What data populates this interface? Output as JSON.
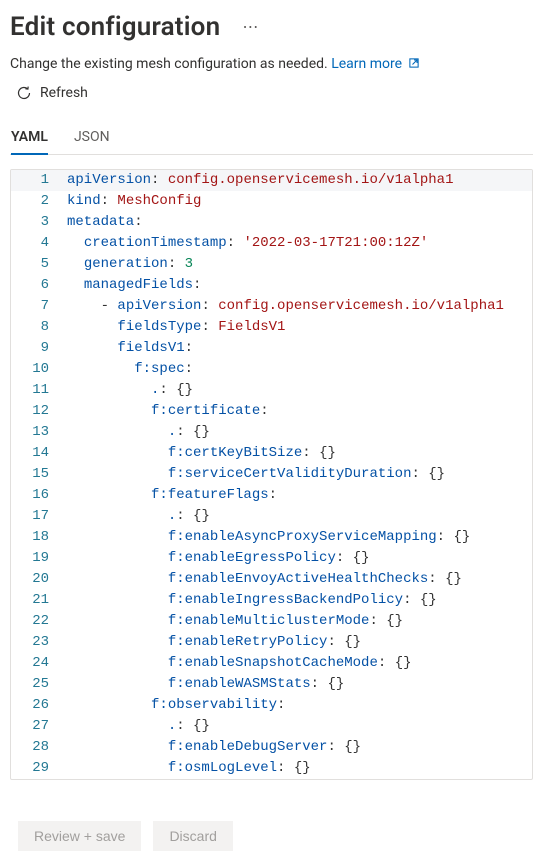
{
  "header": {
    "title": "Edit configuration"
  },
  "description": {
    "text": "Change the existing mesh configuration as needed. ",
    "learn_more": "Learn more"
  },
  "toolbar": {
    "refresh": "Refresh"
  },
  "tabs": {
    "items": [
      {
        "label": "YAML"
      },
      {
        "label": "JSON"
      }
    ],
    "active_index": 0
  },
  "editor": {
    "lines": [
      {
        "n": 1,
        "indent": 0,
        "active": true,
        "tokens": [
          {
            "t": "apiVersion",
            "c": "key"
          },
          {
            "t": ": ",
            "c": "plain"
          },
          {
            "t": "config.openservicemesh.io/v1alpha1",
            "c": "str"
          }
        ]
      },
      {
        "n": 2,
        "indent": 0,
        "tokens": [
          {
            "t": "kind",
            "c": "key"
          },
          {
            "t": ": ",
            "c": "plain"
          },
          {
            "t": "MeshConfig",
            "c": "str"
          }
        ]
      },
      {
        "n": 3,
        "indent": 0,
        "tokens": [
          {
            "t": "metadata",
            "c": "key"
          },
          {
            "t": ":",
            "c": "plain"
          }
        ]
      },
      {
        "n": 4,
        "indent": 1,
        "tokens": [
          {
            "t": "creationTimestamp",
            "c": "key"
          },
          {
            "t": ": ",
            "c": "plain"
          },
          {
            "t": "'2022-03-17T21:00:12Z'",
            "c": "str"
          }
        ]
      },
      {
        "n": 5,
        "indent": 1,
        "tokens": [
          {
            "t": "generation",
            "c": "key"
          },
          {
            "t": ": ",
            "c": "plain"
          },
          {
            "t": "3",
            "c": "num"
          }
        ]
      },
      {
        "n": 6,
        "indent": 1,
        "tokens": [
          {
            "t": "managedFields",
            "c": "key"
          },
          {
            "t": ":",
            "c": "plain"
          }
        ]
      },
      {
        "n": 7,
        "indent": 2,
        "tokens": [
          {
            "t": "- ",
            "c": "plain"
          },
          {
            "t": "apiVersion",
            "c": "key"
          },
          {
            "t": ": ",
            "c": "plain"
          },
          {
            "t": "config.openservicemesh.io/v1alpha1",
            "c": "str"
          }
        ]
      },
      {
        "n": 8,
        "indent": 3,
        "tokens": [
          {
            "t": "fieldsType",
            "c": "key"
          },
          {
            "t": ": ",
            "c": "plain"
          },
          {
            "t": "FieldsV1",
            "c": "str"
          }
        ]
      },
      {
        "n": 9,
        "indent": 3,
        "tokens": [
          {
            "t": "fieldsV1",
            "c": "key"
          },
          {
            "t": ":",
            "c": "plain"
          }
        ]
      },
      {
        "n": 10,
        "indent": 4,
        "tokens": [
          {
            "t": "f:spec",
            "c": "key"
          },
          {
            "t": ":",
            "c": "plain"
          }
        ]
      },
      {
        "n": 11,
        "indent": 5,
        "tokens": [
          {
            "t": ".",
            "c": "key"
          },
          {
            "t": ": ",
            "c": "plain"
          },
          {
            "t": "{}",
            "c": "plain"
          }
        ]
      },
      {
        "n": 12,
        "indent": 5,
        "tokens": [
          {
            "t": "f:certificate",
            "c": "key"
          },
          {
            "t": ":",
            "c": "plain"
          }
        ]
      },
      {
        "n": 13,
        "indent": 6,
        "tokens": [
          {
            "t": ".",
            "c": "key"
          },
          {
            "t": ": ",
            "c": "plain"
          },
          {
            "t": "{}",
            "c": "plain"
          }
        ]
      },
      {
        "n": 14,
        "indent": 6,
        "tokens": [
          {
            "t": "f:certKeyBitSize",
            "c": "key"
          },
          {
            "t": ": ",
            "c": "plain"
          },
          {
            "t": "{}",
            "c": "plain"
          }
        ]
      },
      {
        "n": 15,
        "indent": 6,
        "tokens": [
          {
            "t": "f:serviceCertValidityDuration",
            "c": "key"
          },
          {
            "t": ": ",
            "c": "plain"
          },
          {
            "t": "{}",
            "c": "plain"
          }
        ]
      },
      {
        "n": 16,
        "indent": 5,
        "tokens": [
          {
            "t": "f:featureFlags",
            "c": "key"
          },
          {
            "t": ":",
            "c": "plain"
          }
        ]
      },
      {
        "n": 17,
        "indent": 6,
        "tokens": [
          {
            "t": ".",
            "c": "key"
          },
          {
            "t": ": ",
            "c": "plain"
          },
          {
            "t": "{}",
            "c": "plain"
          }
        ]
      },
      {
        "n": 18,
        "indent": 6,
        "tokens": [
          {
            "t": "f:enableAsyncProxyServiceMapping",
            "c": "key"
          },
          {
            "t": ": ",
            "c": "plain"
          },
          {
            "t": "{}",
            "c": "plain"
          }
        ]
      },
      {
        "n": 19,
        "indent": 6,
        "tokens": [
          {
            "t": "f:enableEgressPolicy",
            "c": "key"
          },
          {
            "t": ": ",
            "c": "plain"
          },
          {
            "t": "{}",
            "c": "plain"
          }
        ]
      },
      {
        "n": 20,
        "indent": 6,
        "tokens": [
          {
            "t": "f:enableEnvoyActiveHealthChecks",
            "c": "key"
          },
          {
            "t": ": ",
            "c": "plain"
          },
          {
            "t": "{}",
            "c": "plain"
          }
        ]
      },
      {
        "n": 21,
        "indent": 6,
        "tokens": [
          {
            "t": "f:enableIngressBackendPolicy",
            "c": "key"
          },
          {
            "t": ": ",
            "c": "plain"
          },
          {
            "t": "{}",
            "c": "plain"
          }
        ]
      },
      {
        "n": 22,
        "indent": 6,
        "tokens": [
          {
            "t": "f:enableMulticlusterMode",
            "c": "key"
          },
          {
            "t": ": ",
            "c": "plain"
          },
          {
            "t": "{}",
            "c": "plain"
          }
        ]
      },
      {
        "n": 23,
        "indent": 6,
        "tokens": [
          {
            "t": "f:enableRetryPolicy",
            "c": "key"
          },
          {
            "t": ": ",
            "c": "plain"
          },
          {
            "t": "{}",
            "c": "plain"
          }
        ]
      },
      {
        "n": 24,
        "indent": 6,
        "tokens": [
          {
            "t": "f:enableSnapshotCacheMode",
            "c": "key"
          },
          {
            "t": ": ",
            "c": "plain"
          },
          {
            "t": "{}",
            "c": "plain"
          }
        ]
      },
      {
        "n": 25,
        "indent": 6,
        "tokens": [
          {
            "t": "f:enableWASMStats",
            "c": "key"
          },
          {
            "t": ": ",
            "c": "plain"
          },
          {
            "t": "{}",
            "c": "plain"
          }
        ]
      },
      {
        "n": 26,
        "indent": 5,
        "tokens": [
          {
            "t": "f:observability",
            "c": "key"
          },
          {
            "t": ":",
            "c": "plain"
          }
        ]
      },
      {
        "n": 27,
        "indent": 6,
        "tokens": [
          {
            "t": ".",
            "c": "key"
          },
          {
            "t": ": ",
            "c": "plain"
          },
          {
            "t": "{}",
            "c": "plain"
          }
        ]
      },
      {
        "n": 28,
        "indent": 6,
        "tokens": [
          {
            "t": "f:enableDebugServer",
            "c": "key"
          },
          {
            "t": ": ",
            "c": "plain"
          },
          {
            "t": "{}",
            "c": "plain"
          }
        ]
      },
      {
        "n": 29,
        "indent": 6,
        "tokens": [
          {
            "t": "f:osmLogLevel",
            "c": "key"
          },
          {
            "t": ": ",
            "c": "plain"
          },
          {
            "t": "{}",
            "c": "plain"
          }
        ]
      }
    ]
  },
  "footer": {
    "review_save": "Review + save",
    "discard": "Discard"
  }
}
